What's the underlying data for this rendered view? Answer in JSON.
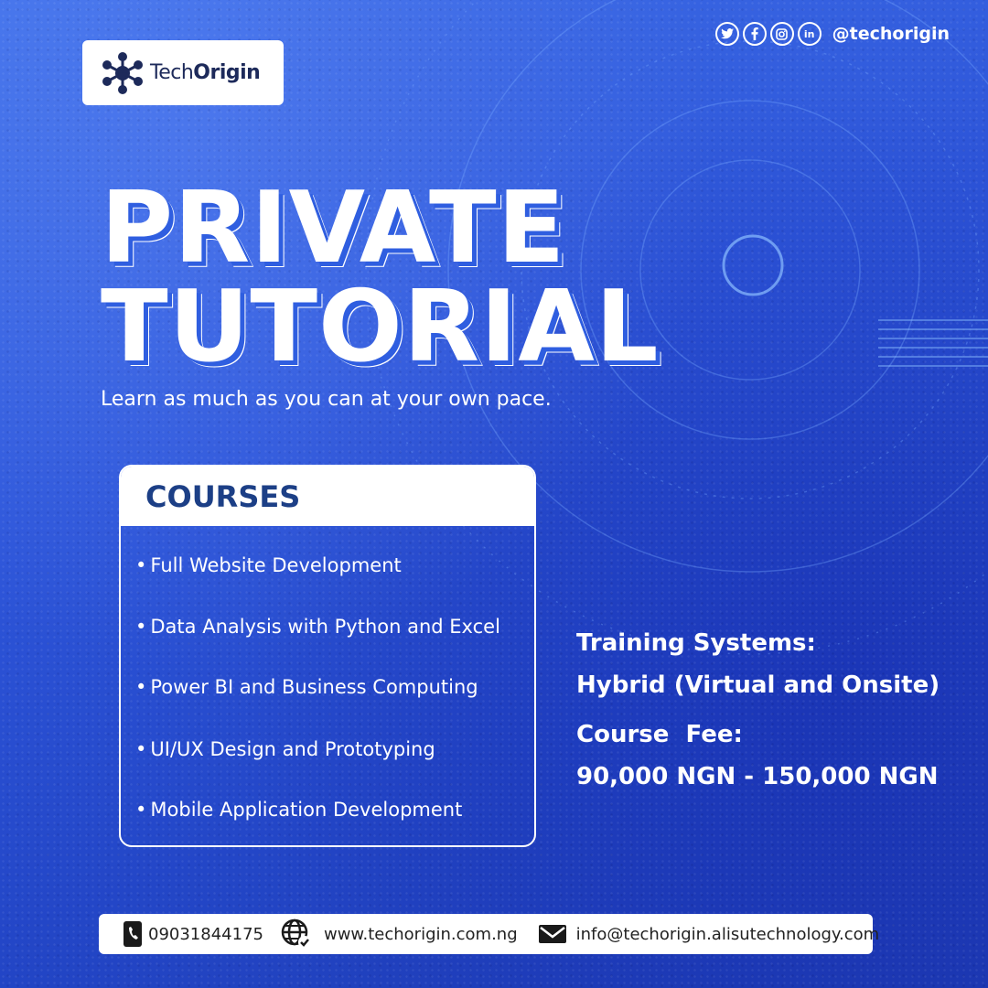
{
  "brand": {
    "name_regular": "Tech",
    "name_bold": "Origin"
  },
  "social": {
    "icons": [
      "twitter-icon",
      "facebook-icon",
      "instagram-icon",
      "linkedin-icon"
    ],
    "handle": "@techorigin"
  },
  "headline": {
    "line1": "PRIVATE",
    "line2": "TUTORIAL"
  },
  "tagline": "Learn as much as you can at your own pace.",
  "courses": {
    "title": "COURSES",
    "items": [
      "Full Website Development",
      "Data Analysis with Python and Excel",
      "Power BI and Business Computing",
      "UI/UX Design and Prototyping",
      "Mobile Application Development"
    ]
  },
  "training": {
    "label": "Training Systems:",
    "value": "Hybrid (Virtual and Onsite)",
    "fee_label": "Course  Fee:",
    "fee_value": "90,000 NGN - 150,000 NGN"
  },
  "contact": {
    "phone": "09031844175",
    "website": "www.techorigin.com.ng",
    "email": "info@techorigin.alisutechnology.com"
  },
  "colors": {
    "background": "#2d55d9",
    "card_title": "#1c3f86",
    "white": "#ffffff"
  }
}
